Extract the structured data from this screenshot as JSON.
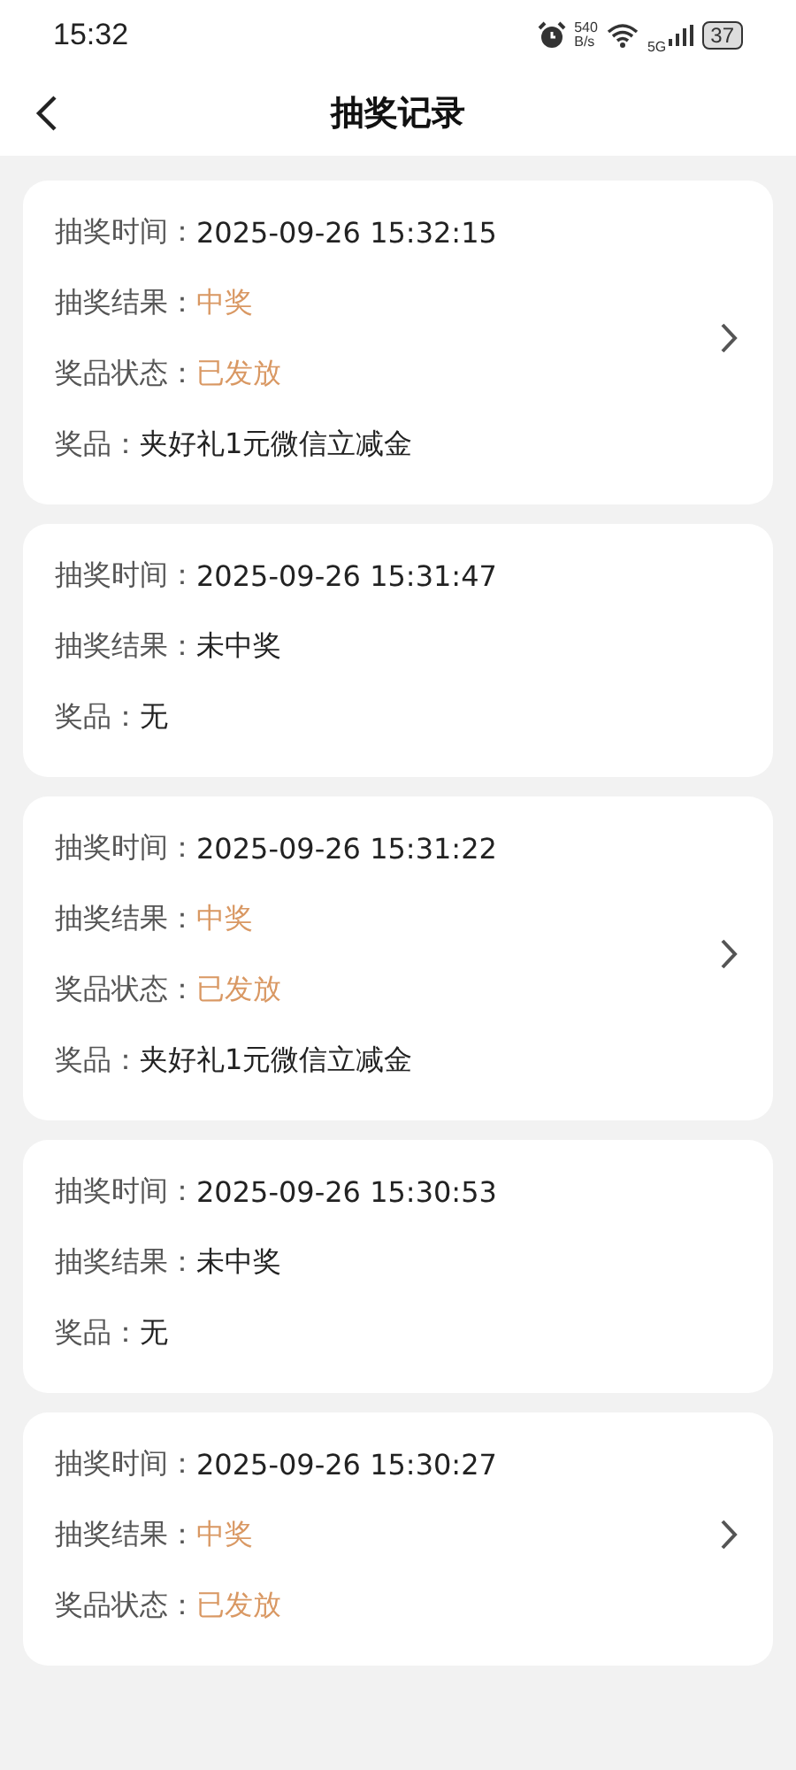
{
  "status_bar": {
    "time": "15:32",
    "speed_value": "540",
    "speed_unit": "B/s",
    "network": "5G",
    "battery": "37"
  },
  "header": {
    "title": "抽奖记录"
  },
  "records": [
    {
      "arrow": true,
      "rows": [
        {
          "label": "抽奖时间：",
          "value": "2025-09-26 15:32:15",
          "highlight": false
        },
        {
          "label": "抽奖结果：",
          "value": "中奖",
          "highlight": true
        },
        {
          "label": "奖品状态：",
          "value": "已发放",
          "highlight": true
        },
        {
          "label": "奖品：",
          "value": "夹好礼1元微信立减金",
          "highlight": false
        }
      ]
    },
    {
      "arrow": false,
      "rows": [
        {
          "label": "抽奖时间：",
          "value": "2025-09-26 15:31:47",
          "highlight": false
        },
        {
          "label": "抽奖结果：",
          "value": "未中奖",
          "highlight": false
        },
        {
          "label": "奖品：",
          "value": "无",
          "highlight": false
        }
      ]
    },
    {
      "arrow": true,
      "rows": [
        {
          "label": "抽奖时间：",
          "value": "2025-09-26 15:31:22",
          "highlight": false
        },
        {
          "label": "抽奖结果：",
          "value": "中奖",
          "highlight": true
        },
        {
          "label": "奖品状态：",
          "value": "已发放",
          "highlight": true
        },
        {
          "label": "奖品：",
          "value": "夹好礼1元微信立减金",
          "highlight": false
        }
      ]
    },
    {
      "arrow": false,
      "rows": [
        {
          "label": "抽奖时间：",
          "value": "2025-09-26 15:30:53",
          "highlight": false
        },
        {
          "label": "抽奖结果：",
          "value": "未中奖",
          "highlight": false
        },
        {
          "label": "奖品：",
          "value": "无",
          "highlight": false
        }
      ]
    },
    {
      "arrow": true,
      "rows": [
        {
          "label": "抽奖时间：",
          "value": "2025-09-26 15:30:27",
          "highlight": false
        },
        {
          "label": "抽奖结果：",
          "value": "中奖",
          "highlight": true
        },
        {
          "label": "奖品状态：",
          "value": "已发放",
          "highlight": true
        }
      ]
    }
  ]
}
